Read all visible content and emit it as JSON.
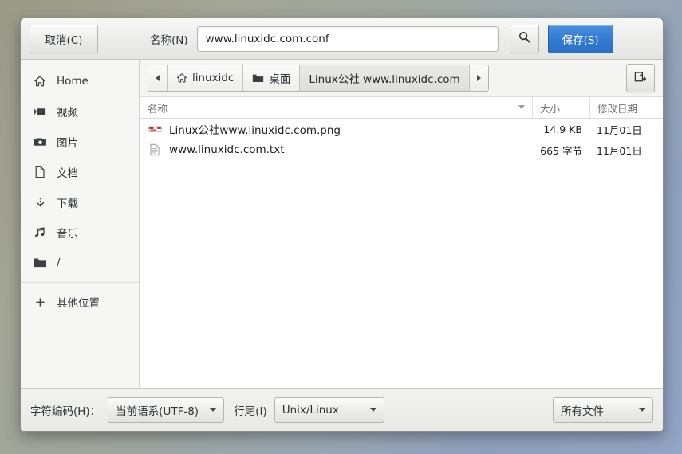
{
  "dialog": {
    "cancel_label": "取消(C)",
    "name_label": "名称(N)",
    "name_value": "www.linuxidc.com.conf",
    "name_placeholder": "",
    "save_label": "保存(S)",
    "search_icon": "search-icon",
    "new_folder_icon": "new-folder-icon"
  },
  "sidebar": {
    "items": [
      {
        "label": "Home",
        "icon": "home-icon"
      },
      {
        "label": "视频",
        "icon": "video-icon"
      },
      {
        "label": "图片",
        "icon": "camera-icon"
      },
      {
        "label": "文档",
        "icon": "document-icon"
      },
      {
        "label": "下载",
        "icon": "download-icon"
      },
      {
        "label": "音乐",
        "icon": "music-icon"
      },
      {
        "label": "/",
        "icon": "folder-icon"
      }
    ],
    "other_locations": {
      "label": "其他位置",
      "icon": "plus-icon"
    }
  },
  "pathbar": {
    "back_icon": "chevron-left-icon",
    "forward_icon": "chevron-right-icon",
    "crumbs": [
      {
        "label": "linuxidc",
        "icon": "home-icon",
        "current": false
      },
      {
        "label": "桌面",
        "icon": "folder-icon",
        "current": false
      },
      {
        "label": "Linux公社  www.linuxidc.com",
        "icon": "",
        "current": true
      }
    ]
  },
  "filelist": {
    "columns": {
      "name": "名称",
      "size": "大小",
      "date": "修改日期",
      "sort_arrow": "chevron-down-icon"
    },
    "rows": [
      {
        "name": "Linux公社www.linuxidc.com.png",
        "size": "14.9 KB",
        "date": "11月01日",
        "icon": "image-thumbnail-icon"
      },
      {
        "name": "www.linuxidc.com.txt",
        "size": "665 字节",
        "date": "11月01日",
        "icon": "text-file-icon"
      }
    ]
  },
  "footer": {
    "encoding_label": "字符编码(H)：",
    "encoding_value": "当前语系(UTF-8)",
    "eol_label": "行尾(I)",
    "eol_value": "Unix/Linux",
    "filter_value": "所有文件"
  },
  "colors": {
    "accent": "#337cd3",
    "window_bg": "#f4f4f2",
    "list_bg": "#ffffff",
    "text": "#2e3436"
  }
}
